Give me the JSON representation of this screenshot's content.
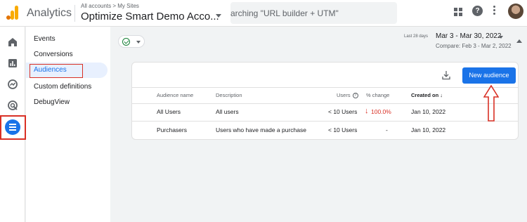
{
  "header": {
    "app_title": "Analytics",
    "breadcrumb": "All accounts > My Sites",
    "account_name": "Optimize Smart Demo Acco...",
    "search_text": "arching \"URL builder + UTM\"",
    "help_glyph": "?"
  },
  "rail": {
    "icons": [
      "home-icon",
      "reports-icon",
      "explore-icon",
      "advertising-icon",
      "configure-icon"
    ],
    "active": "configure-icon"
  },
  "subnav": {
    "items": [
      "Events",
      "Conversions",
      "Audiences",
      "Custom definitions",
      "DebugView"
    ],
    "active": "Audiences"
  },
  "date": {
    "badge": "Last 28 days",
    "range": "Mar 3 - Mar 30, 2022",
    "compare": "Compare: Feb 3 - Mar 2, 2022"
  },
  "toolbar": {
    "new_audience_label": "New audience"
  },
  "table": {
    "columns": {
      "name": "Audience name",
      "description": "Description",
      "users": "Users",
      "pct_change": "% change",
      "created_on": "Created on"
    },
    "info_glyph": "?",
    "sort_glyph": "↓",
    "rows": [
      {
        "name": "All Users",
        "description": "All users",
        "users": "< 10 Users",
        "pct_change": "100.0%",
        "pct_arrow": "↓",
        "created_on": "Jan 10, 2022"
      },
      {
        "name": "Purchasers",
        "description": "Users who have made a purchase",
        "users": "< 10 Users",
        "pct_change": "-",
        "pct_arrow": "",
        "created_on": "Jan 10, 2022"
      }
    ]
  },
  "colors": {
    "accent": "#1a73e8",
    "annotation": "#d93025",
    "logo_orange": "#f9ab00",
    "positive": "#188038",
    "negative": "#d93025"
  }
}
